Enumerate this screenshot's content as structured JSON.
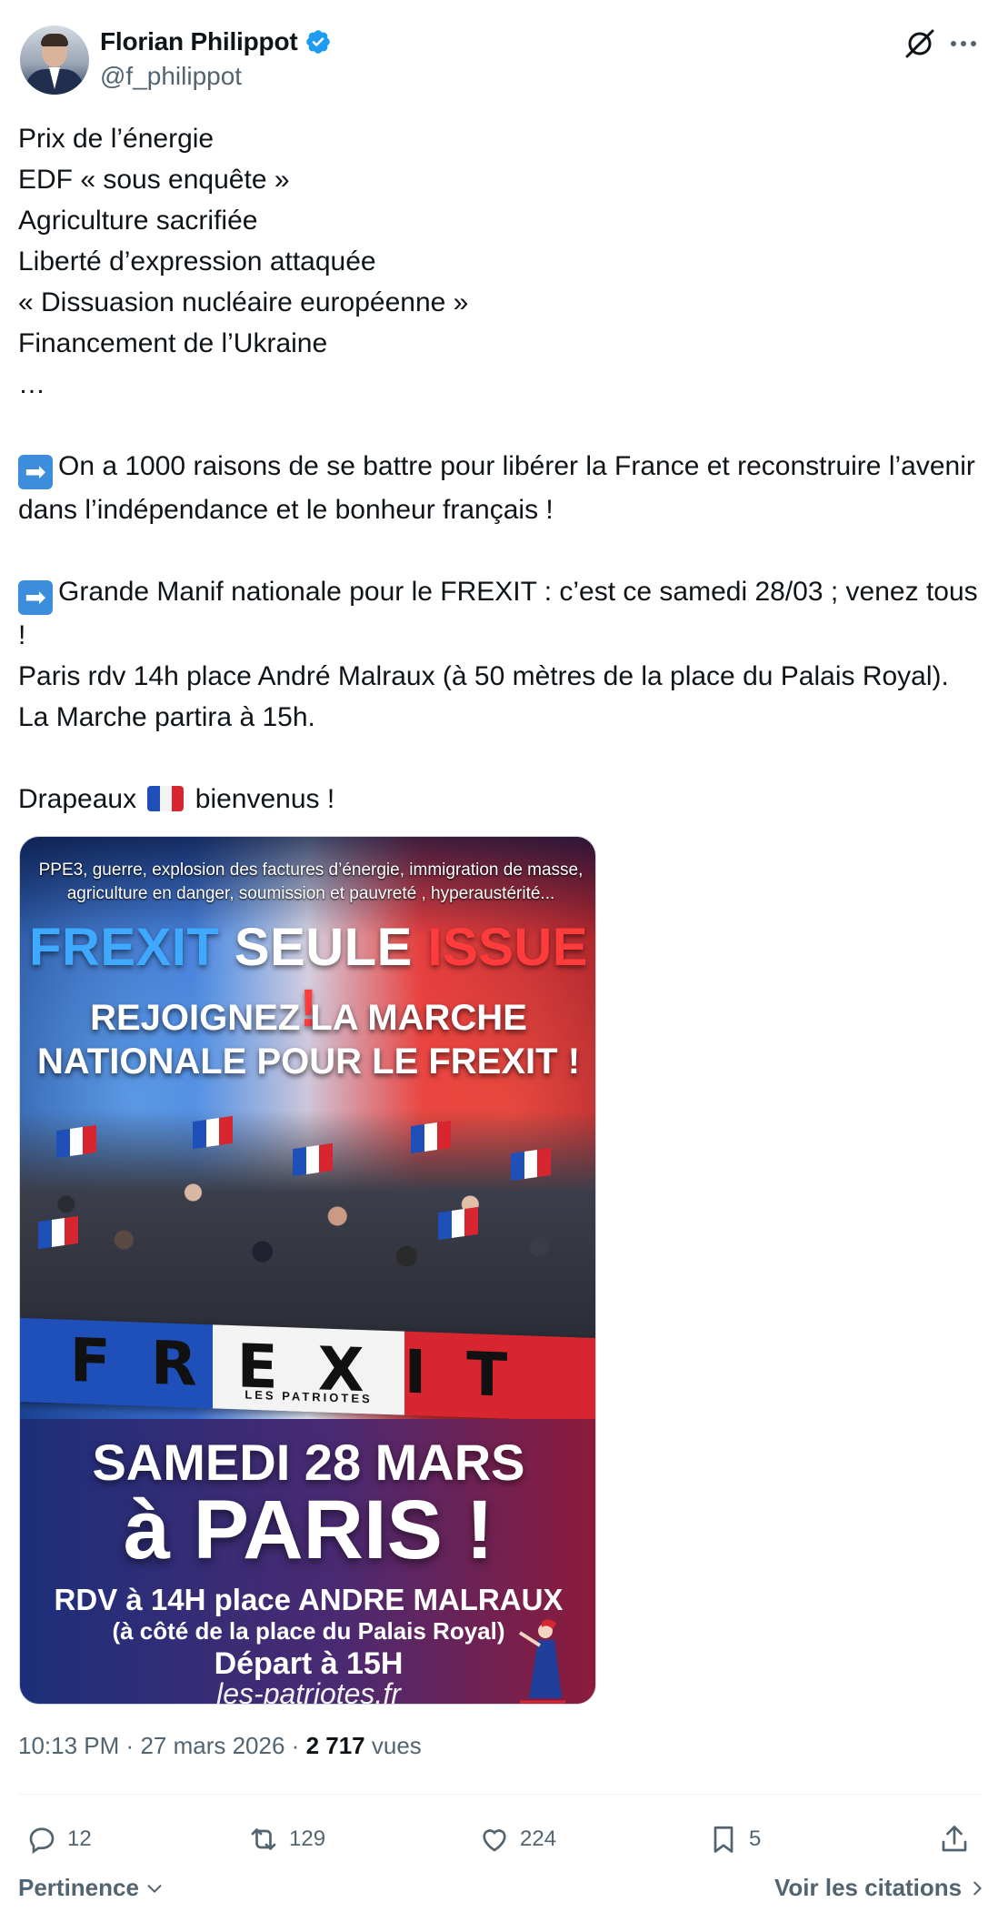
{
  "author": {
    "display_name": "Florian Philippot",
    "handle": "@f_philippot",
    "verified_color": "#1d9bf0"
  },
  "header_icons": [
    "grok-icon",
    "more-icon"
  ],
  "tweet": {
    "lines_block1": "Prix de l’énergie\nEDF « sous enquête »\nAgriculture sacrifiée\nLiberté d’expression attaquée\n« Dissuasion nucléaire européenne »\nFinancement de l’Ukraine\n…",
    "arrow_emoji": "➡",
    "para2": "On a 1000 raisons de se battre pour libérer la France et reconstruire l’avenir dans l’indépendance et le bonheur français !",
    "para3_head": "Grande Manif nationale pour le FREXIT : c’est ce samedi 28/03 ; venez tous !",
    "para3_rest": "Paris rdv 14h place André Malraux (à 50 mètres de la place du Palais Royal). La Marche partira à 15h.",
    "para4_before": "Drapeaux",
    "para4_after": "bienvenus !"
  },
  "poster": {
    "top_text": "PPE3, guerre, explosion des factures d’énergie, immigration de masse, agriculture en danger, soumission et pauvreté , hyperaustérité...",
    "slogan_1": "FREXIT",
    "slogan_2": "SEULE",
    "slogan_3": "ISSUE !",
    "call_line1": "REJOIGNEZ LA MARCHE",
    "call_line2": "NATIONALE POUR LE FREXIT !",
    "banner_text": "FREXIT",
    "banner_sub": "LES PATRIOTES",
    "date": "SAMEDI 28 MARS",
    "city": "à PARIS !",
    "rdv": "RDV à 14H place ANDRE MALRAUX",
    "near": "(à côté de la place du Palais Royal)",
    "depart": "Départ à 15H",
    "site": "les-patriotes.fr"
  },
  "meta": {
    "time": "10:13 PM",
    "sep": "·",
    "date": "27 mars 2026",
    "views_count": "2 717",
    "views_label": "vues"
  },
  "actions": {
    "replies": "12",
    "reposts": "129",
    "likes": "224",
    "bookmarks": "5"
  },
  "footer": {
    "sort_label": "Pertinence",
    "quotes_label": "Voir les citations"
  },
  "colors": {
    "text": "#0f1419",
    "secondary": "#536471",
    "accent": "#1d9bf0"
  }
}
